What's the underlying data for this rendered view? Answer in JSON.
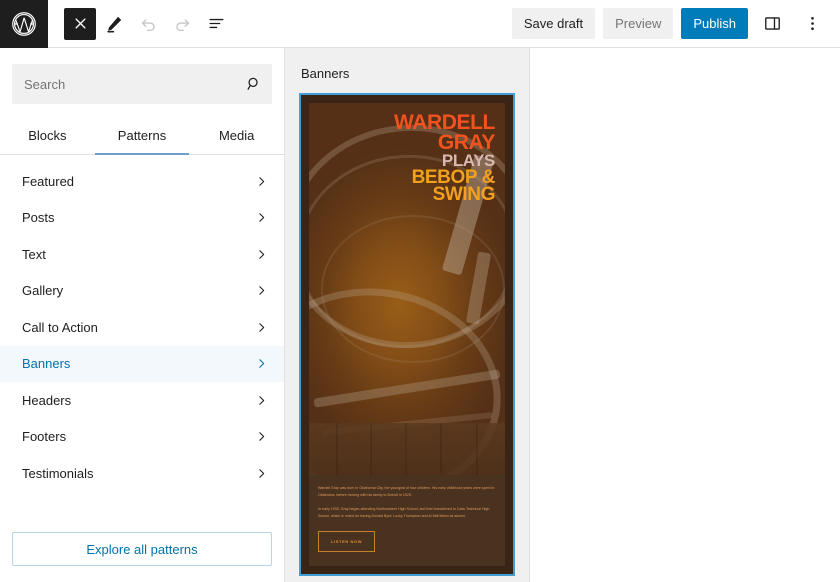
{
  "toolbar": {
    "logo_icon": "wordpress-logo-icon",
    "close_icon": "close-icon",
    "edit_icon": "pencil-edit-icon",
    "undo_icon": "undo-icon",
    "redo_icon": "redo-icon",
    "outline_icon": "document-outline-icon",
    "save_draft_label": "Save draft",
    "preview_label": "Preview",
    "publish_label": "Publish",
    "sidebar_toggle_icon": "sidebar-panel-icon",
    "options_icon": "more-options-icon",
    "publish_color": "#007cba"
  },
  "inserter": {
    "search": {
      "placeholder": "Search",
      "value": "",
      "icon": "search-icon"
    },
    "tabs": [
      {
        "label": "Blocks",
        "active": false
      },
      {
        "label": "Patterns",
        "active": true
      },
      {
        "label": "Media",
        "active": false
      }
    ],
    "active_tab_color": "#6b9ec9",
    "categories": [
      {
        "label": "Featured",
        "selected": false
      },
      {
        "label": "Posts",
        "selected": false
      },
      {
        "label": "Text",
        "selected": false
      },
      {
        "label": "Gallery",
        "selected": false
      },
      {
        "label": "Call to Action",
        "selected": false
      },
      {
        "label": "Banners",
        "selected": true
      },
      {
        "label": "Headers",
        "selected": false
      },
      {
        "label": "Footers",
        "selected": false
      },
      {
        "label": "Testimonials",
        "selected": false
      }
    ],
    "selected_color": "#0073aa",
    "explore_label": "Explore all patterns"
  },
  "preview": {
    "title": "Banners",
    "focus_color": "#3f9fd6",
    "pattern": {
      "headline": {
        "line1": "WARDELL",
        "line2": "GRAY",
        "line3": "PLAYS",
        "line4": "BEBOP &",
        "line5": "SWING",
        "color_name": "#f0531f",
        "color_plays": "#d8b8b0",
        "color_bebop": "#f2a01e"
      },
      "image_alt": "spiral-staircase-photo",
      "paragraph1": "Wardell Gray was born in Oklahoma City, the youngest of four children. His early childhood years were spent in Oklahoma, before moving with his family to Detroit in 1929.",
      "paragraph2": "In early 1935, Gray began attending Northeastern High School, and then transferred to Cass Technical High School, which is noted for having Donald Byrd, Lucky Thompson and Al McKibbon as alumni.",
      "button_label": "LISTEN NOW",
      "background": "#4a3220",
      "text_color": "#e09a5a"
    }
  },
  "canvas": {
    "add_block_icon": "plus-icon"
  }
}
